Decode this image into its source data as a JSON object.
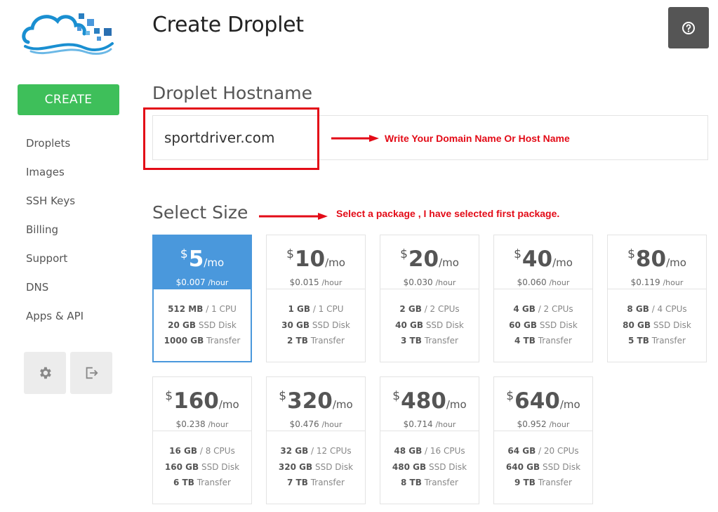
{
  "header": {
    "title": "Create Droplet",
    "help_icon": "question-circle-icon"
  },
  "sidebar": {
    "create_label": "CREATE",
    "items": [
      {
        "label": "Droplets"
      },
      {
        "label": "Images"
      },
      {
        "label": "SSH Keys"
      },
      {
        "label": "Billing"
      },
      {
        "label": "Support"
      },
      {
        "label": "DNS"
      },
      {
        "label": "Apps & API"
      }
    ],
    "settings_icon": "gear-icon",
    "logout_icon": "logout-icon"
  },
  "hostname": {
    "title": "Droplet Hostname",
    "value": "sportdriver.com",
    "annotation": "Write Your Domain Name Or Host Name"
  },
  "size": {
    "title": "Select Size",
    "annotation": "Select a package , I have selected first package.",
    "currency": "$",
    "per_month": "/mo",
    "per_hour": "/hour",
    "plans": [
      {
        "price": "5",
        "hourly": "$0.007",
        "ram": "512 MB",
        "cpu": "/ 1 CPU",
        "disk": "20 GB",
        "disk_label": "SSD Disk",
        "transfer": "1000 GB",
        "transfer_label": "Transfer",
        "selected": true
      },
      {
        "price": "10",
        "hourly": "$0.015",
        "ram": "1 GB",
        "cpu": "/ 1 CPU",
        "disk": "30 GB",
        "disk_label": "SSD Disk",
        "transfer": "2 TB",
        "transfer_label": "Transfer"
      },
      {
        "price": "20",
        "hourly": "$0.030",
        "ram": "2 GB",
        "cpu": "/ 2 CPUs",
        "disk": "40 GB",
        "disk_label": "SSD Disk",
        "transfer": "3 TB",
        "transfer_label": "Transfer"
      },
      {
        "price": "40",
        "hourly": "$0.060",
        "ram": "4 GB",
        "cpu": "/ 2 CPUs",
        "disk": "60 GB",
        "disk_label": "SSD Disk",
        "transfer": "4 TB",
        "transfer_label": "Transfer"
      },
      {
        "price": "80",
        "hourly": "$0.119",
        "ram": "8 GB",
        "cpu": "/ 4 CPUs",
        "disk": "80 GB",
        "disk_label": "SSD Disk",
        "transfer": "5 TB",
        "transfer_label": "Transfer"
      },
      {
        "price": "160",
        "hourly": "$0.238",
        "ram": "16 GB",
        "cpu": "/ 8 CPUs",
        "disk": "160 GB",
        "disk_label": "SSD Disk",
        "transfer": "6 TB",
        "transfer_label": "Transfer"
      },
      {
        "price": "320",
        "hourly": "$0.476",
        "ram": "32 GB",
        "cpu": "/ 12 CPUs",
        "disk": "320 GB",
        "disk_label": "SSD Disk",
        "transfer": "7 TB",
        "transfer_label": "Transfer"
      },
      {
        "price": "480",
        "hourly": "$0.714",
        "ram": "48 GB",
        "cpu": "/ 16 CPUs",
        "disk": "480 GB",
        "disk_label": "SSD Disk",
        "transfer": "8 TB",
        "transfer_label": "Transfer"
      },
      {
        "price": "640",
        "hourly": "$0.952",
        "ram": "64 GB",
        "cpu": "/ 20 CPUs",
        "disk": "640 GB",
        "disk_label": "SSD Disk",
        "transfer": "9 TB",
        "transfer_label": "Transfer"
      }
    ]
  },
  "colors": {
    "accent_green": "#3ebf5a",
    "selected_blue": "#4a98dc",
    "annotation_red": "#e30b17",
    "logo_blue": "#1a8fd1"
  }
}
